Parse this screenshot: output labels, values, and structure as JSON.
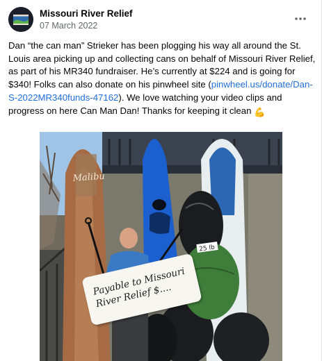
{
  "page": {
    "name": "Missouri River Relief",
    "date": "07 March 2022",
    "avatar_label": "MISSOURI RIVER RELIEF"
  },
  "icons": {
    "more": "more-options-icon",
    "emoji": "flexed-biceps-emoji"
  },
  "post": {
    "text_before_link": "Dan “the can man” Strieker has been plogging his way all around the St. Louis area picking up and collecting cans on behalf of Missouri River Relief, as part of his MR340 fundraiser.  He’s currently at $224 and is going for $340!  Folks can also donate on his pinwheel site (",
    "link_text": "pinwheel.us/donate/Dan-S-2022MR340funds-47162",
    "text_after_link": "). We love watching your video clips and progress on here Can Man Dan!  Thanks for keeping it clean ",
    "emoji": "💪"
  },
  "photo": {
    "sign_line1": "Payable to Missouri",
    "sign_line2": "River Relief  $....",
    "board_brand": "Malibu",
    "bag_tag": "25 lb"
  },
  "colors": {
    "link": "#216fdb",
    "secondary_text": "#65676b"
  }
}
